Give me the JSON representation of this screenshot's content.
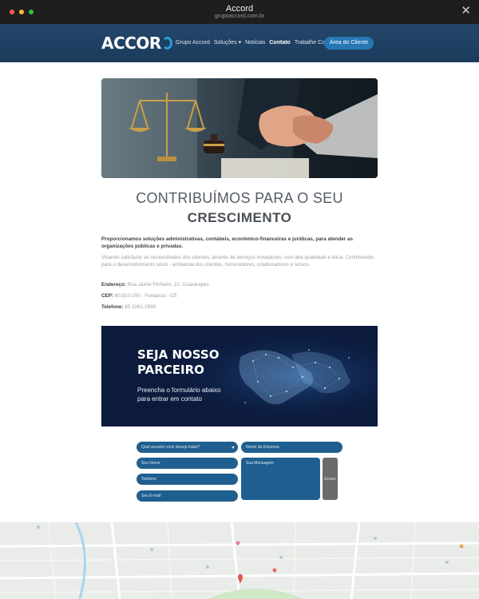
{
  "window": {
    "title": "Accord",
    "url": "grupoaccord.com.br"
  },
  "colors": {
    "navbar": "#1f4266",
    "accent": "#2677b4",
    "form_field": "#1f5f8f",
    "banner_bg": "#0c1a3c"
  },
  "header": {
    "logo_text": "ACCOR",
    "nav": [
      "Grupo Accord",
      "Soluções",
      "Notícias",
      "Contato",
      "Trabalhe Conosco"
    ],
    "active_nav": "Contato",
    "cta": "Área do Cliente"
  },
  "main": {
    "heading_line1": "CONTRIBUÍMOS PARA O SEU",
    "heading_line2": "CRESCIMENTO",
    "intro_bold": "Proporcionamos soluções administrativas, contábeis, econômico-financeiras e jurídicas, para atender as organizações públicas e privadas.",
    "intro_light": "Visando satisfazer as necessidades dos clientes, através de serviços inovadores, com alta qualidade e ética. Contribuindo para o desenvolvimento sócio - ambiental dos clientes, fornecedores, colaboradores e sócios.",
    "address_label": "Endereço:",
    "address": "Rua Jaime Pinheiro, 21, Guararapes",
    "cep_label": "CEP:",
    "cep": "60.810-250 - Fortaleza - CE",
    "phone_label": "Telefone:",
    "phone": "85 3261-2999"
  },
  "banner": {
    "title_line1": "SEJA NOSSO",
    "title_line2": "PARCEIRO",
    "subtitle_line1": "Preencha o formulário abaixo",
    "subtitle_line2": "para entrar em contato"
  },
  "form": {
    "subject": "Qual assunto você deseja tratar?",
    "company": "Nome da Empresa",
    "name": "Seu Nome",
    "message": "Sua Mensagem",
    "phone": "Telefone",
    "email": "Seu E-mail",
    "send": "Enviar"
  }
}
